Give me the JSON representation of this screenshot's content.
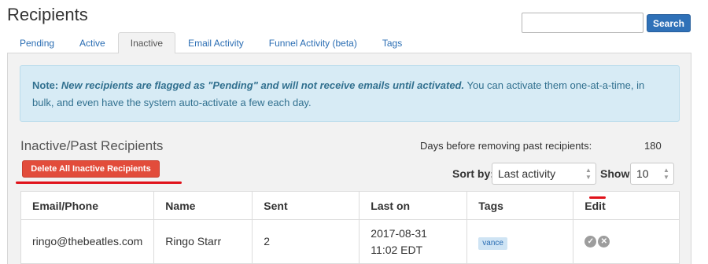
{
  "page": {
    "title": "Recipients"
  },
  "search": {
    "placeholder": "",
    "button_label": "Search"
  },
  "tabs": [
    {
      "label": "Pending"
    },
    {
      "label": "Active"
    },
    {
      "label": "Inactive",
      "active": true
    },
    {
      "label": "Email Activity"
    },
    {
      "label": "Funnel Activity (beta)"
    },
    {
      "label": "Tags"
    }
  ],
  "alert": {
    "prefix": "Note:",
    "emphasis": "New recipients are flagged as \"Pending\" and will not receive emails until activated.",
    "rest": " You can activate them one-at-a-time, in bulk, and even have the system auto-activate a few each day."
  },
  "section": {
    "title": "Inactive/Past Recipients",
    "days_label": "Days before removing past recipients:",
    "days_value": "180",
    "delete_label": "Delete All Inactive Recipients"
  },
  "controls": {
    "sort_label": "Sort by:",
    "sort_value": "Last activity",
    "show_label": "Show",
    "show_value": "10"
  },
  "table": {
    "columns": [
      "Email/Phone",
      "Name",
      "Sent",
      "Last on",
      "Tags",
      "Edit"
    ],
    "rows": [
      {
        "email": "ringo@thebeatles.com",
        "name": "Ringo Starr",
        "sent": "2",
        "last_on_date": "2017-08-31",
        "last_on_time": "11:02 EDT",
        "tag": "vance"
      }
    ]
  },
  "colors": {
    "accent": "#2f71b8",
    "danger": "#e24c3b",
    "alert_bg": "#d7ebf5",
    "annotation": "#e0121a"
  },
  "icons": {
    "activate": "check-circle-icon",
    "deactivate": "x-circle-icon",
    "select_arrows": "updown-arrows-icon"
  }
}
